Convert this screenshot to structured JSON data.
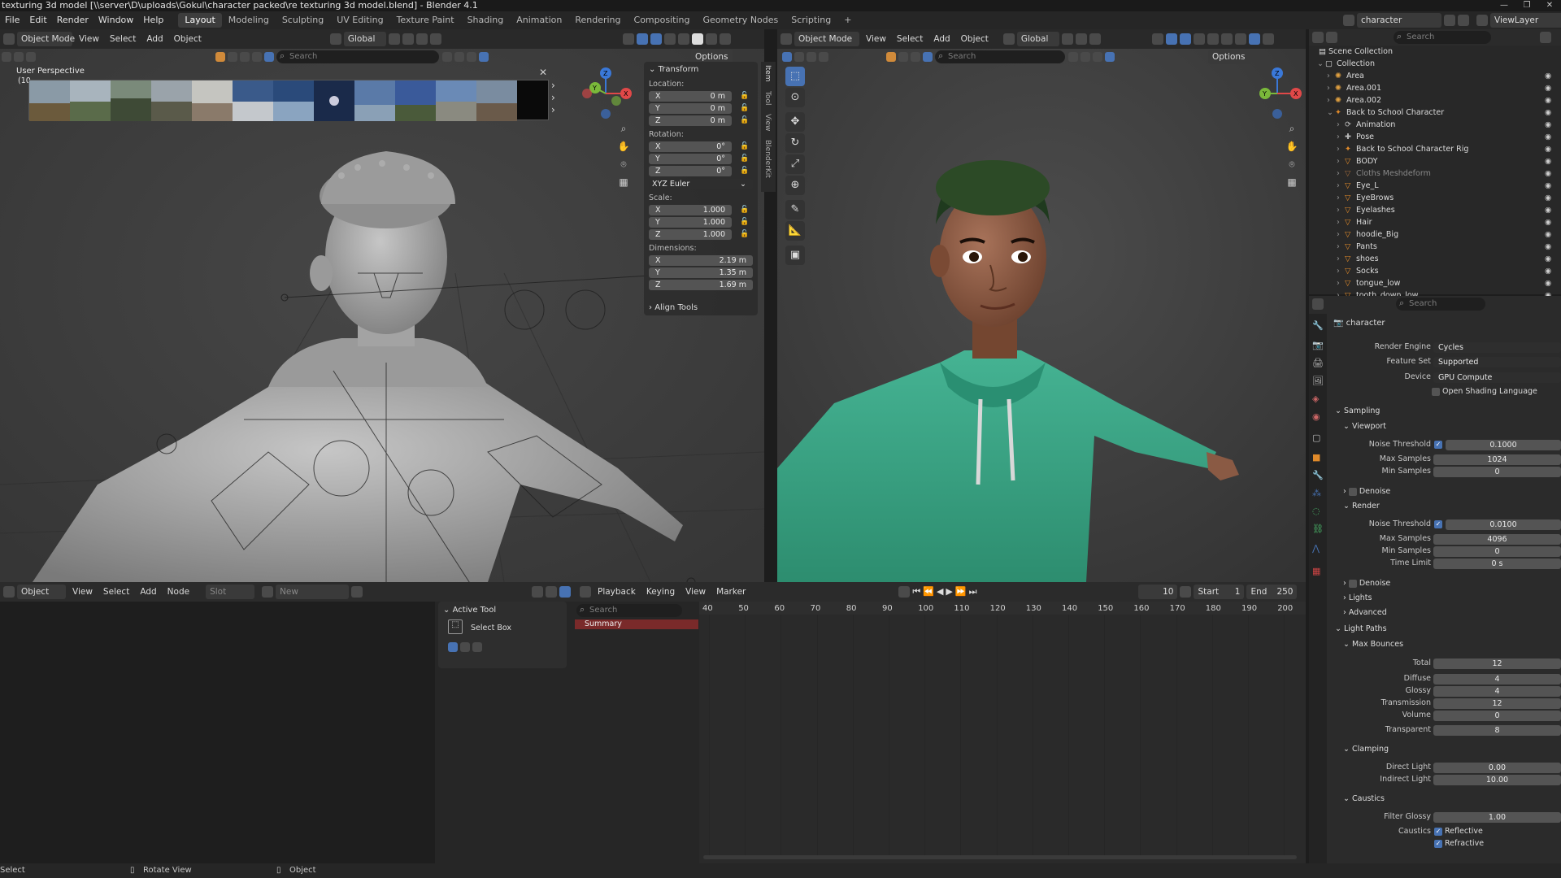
{
  "title": "texturing 3d model [\\\\server\\D\\uploads\\Gokul\\character packed\\re texturing 3d model.blend] - Blender 4.1",
  "menu": [
    "File",
    "Edit",
    "Render",
    "Window",
    "Help"
  ],
  "workspaces": [
    "Layout",
    "Modeling",
    "Sculpting",
    "UV Editing",
    "Texture Paint",
    "Shading",
    "Animation",
    "Rendering",
    "Compositing",
    "Geometry Nodes",
    "Scripting"
  ],
  "active_workspace": "Layout",
  "scene": "character",
  "view_layer": "ViewLayer",
  "left_viewport": {
    "mode": "Object Mode",
    "menus": [
      "View",
      "Select",
      "Add",
      "Object"
    ],
    "orientation": "Global",
    "search_placeholder": "Search",
    "options": "Options",
    "perspective": "User Perspective",
    "perspective_sub": "(10",
    "side_tabs": [
      "Item",
      "Tool",
      "View",
      "BlenderKit"
    ],
    "transform": {
      "title": "Transform",
      "location_label": "Location:",
      "location": [
        {
          "axis": "X",
          "value": "0 m"
        },
        {
          "axis": "Y",
          "value": "0 m"
        },
        {
          "axis": "Z",
          "value": "0 m"
        }
      ],
      "rotation_label": "Rotation:",
      "rotation": [
        {
          "axis": "X",
          "value": "0°"
        },
        {
          "axis": "Y",
          "value": "0°"
        },
        {
          "axis": "Z",
          "value": "0°"
        }
      ],
      "rotation_mode": "XYZ Euler",
      "scale_label": "Scale:",
      "scale": [
        {
          "axis": "X",
          "value": "1.000"
        },
        {
          "axis": "Y",
          "value": "1.000"
        },
        {
          "axis": "Z",
          "value": "1.000"
        }
      ],
      "dimensions_label": "Dimensions:",
      "dimensions": [
        {
          "axis": "X",
          "value": "2.19 m"
        },
        {
          "axis": "Y",
          "value": "1.35 m"
        },
        {
          "axis": "Z",
          "value": "1.69 m"
        }
      ],
      "align_tools": "Align Tools"
    }
  },
  "right_viewport": {
    "mode": "Object Mode",
    "menus": [
      "View",
      "Select",
      "Add",
      "Object"
    ],
    "orientation": "Global",
    "search_placeholder": "Search",
    "options": "Options"
  },
  "outliner": {
    "search_placeholder": "Search",
    "root": "Scene Collection",
    "items": [
      {
        "label": "Collection",
        "indent": 1,
        "kind": "collection"
      },
      {
        "label": "Area",
        "indent": 2,
        "kind": "light"
      },
      {
        "label": "Area.001",
        "indent": 2,
        "kind": "light"
      },
      {
        "label": "Area.002",
        "indent": 2,
        "kind": "light"
      },
      {
        "label": "Back to School Character",
        "indent": 2,
        "kind": "armature"
      },
      {
        "label": "Animation",
        "indent": 3,
        "kind": "anim"
      },
      {
        "label": "Pose",
        "indent": 3,
        "kind": "pose"
      },
      {
        "label": "Back to School Character Rig",
        "indent": 3,
        "kind": "armature"
      },
      {
        "label": "BODY",
        "indent": 3,
        "kind": "mesh"
      },
      {
        "label": "Cloths Meshdeform",
        "indent": 3,
        "kind": "mesh-dim"
      },
      {
        "label": "Eye_L",
        "indent": 3,
        "kind": "mesh"
      },
      {
        "label": "EyeBrows",
        "indent": 3,
        "kind": "mesh"
      },
      {
        "label": "Eyelashes",
        "indent": 3,
        "kind": "mesh"
      },
      {
        "label": "Hair",
        "indent": 3,
        "kind": "mesh"
      },
      {
        "label": "hoodie_Big",
        "indent": 3,
        "kind": "mesh"
      },
      {
        "label": "Pants",
        "indent": 3,
        "kind": "mesh"
      },
      {
        "label": "shoes",
        "indent": 3,
        "kind": "mesh"
      },
      {
        "label": "Socks",
        "indent": 3,
        "kind": "mesh"
      },
      {
        "label": "tongue_low",
        "indent": 3,
        "kind": "mesh"
      },
      {
        "label": "tooth_down_low",
        "indent": 3,
        "kind": "mesh"
      }
    ]
  },
  "properties": {
    "search_placeholder": "Search",
    "context": "character",
    "render_engine_label": "Render Engine",
    "render_engine": "Cycles",
    "feature_set_label": "Feature Set",
    "feature_set": "Supported",
    "device_label": "Device",
    "device": "GPU Compute",
    "osl_label": "Open Shading Language",
    "sampling": "Sampling",
    "viewport": "Viewport",
    "noise_threshold_label": "Noise Threshold",
    "viewport_noise_threshold": "0.1000",
    "max_samples_label": "Max Samples",
    "viewport_max_samples": "1024",
    "min_samples_label": "Min Samples",
    "viewport_min_samples": "0",
    "denoise": "Denoise",
    "render": "Render",
    "render_noise_threshold": "0.0100",
    "render_max_samples": "4096",
    "render_min_samples": "0",
    "time_limit_label": "Time Limit",
    "time_limit": "0 s",
    "lights": "Lights",
    "advanced": "Advanced",
    "light_paths": "Light Paths",
    "max_bounces": "Max Bounces",
    "bounces": [
      {
        "label": "Total",
        "value": "12"
      },
      {
        "label": "Diffuse",
        "value": "4"
      },
      {
        "label": "Glossy",
        "value": "4"
      },
      {
        "label": "Transmission",
        "value": "12"
      },
      {
        "label": "Volume",
        "value": "0"
      },
      {
        "label": "Transparent",
        "value": "8"
      }
    ],
    "clamping": "Clamping",
    "direct_light_label": "Direct Light",
    "direct_light": "0.00",
    "indirect_light_label": "Indirect Light",
    "indirect_light": "10.00",
    "caustics": "Caustics",
    "filter_glossy_label": "Filter Glossy",
    "filter_glossy": "1.00",
    "caustics_label": "Caustics",
    "reflective": "Reflective",
    "refractive": "Refractive"
  },
  "node_editor": {
    "type": "Object",
    "menus": [
      "View",
      "Select",
      "Add",
      "Node"
    ],
    "slot": "Slot",
    "new": "New"
  },
  "tool_panel": {
    "title": "Active Tool",
    "tool": "Select Box"
  },
  "timeline": {
    "menus": [
      "Playback",
      "Keying",
      "View",
      "Marker"
    ],
    "current_frame": "10",
    "start_label": "Start",
    "start": "1",
    "end_label": "End",
    "end": "250",
    "search_placeholder": "Search",
    "summary": "Summary",
    "ticks": [
      "40",
      "50",
      "60",
      "70",
      "80",
      "90",
      "100",
      "110",
      "120",
      "130",
      "140",
      "150",
      "160",
      "170",
      "180",
      "190",
      "200"
    ]
  },
  "status": {
    "left": "Select",
    "mid": "Rotate View",
    "right": "Object"
  },
  "colors": {
    "accent": "#4772b3",
    "hoodie": "#3aa584",
    "axis_x": "#e04848",
    "axis_y": "#7ab93a",
    "axis_z": "#3a78d8"
  }
}
